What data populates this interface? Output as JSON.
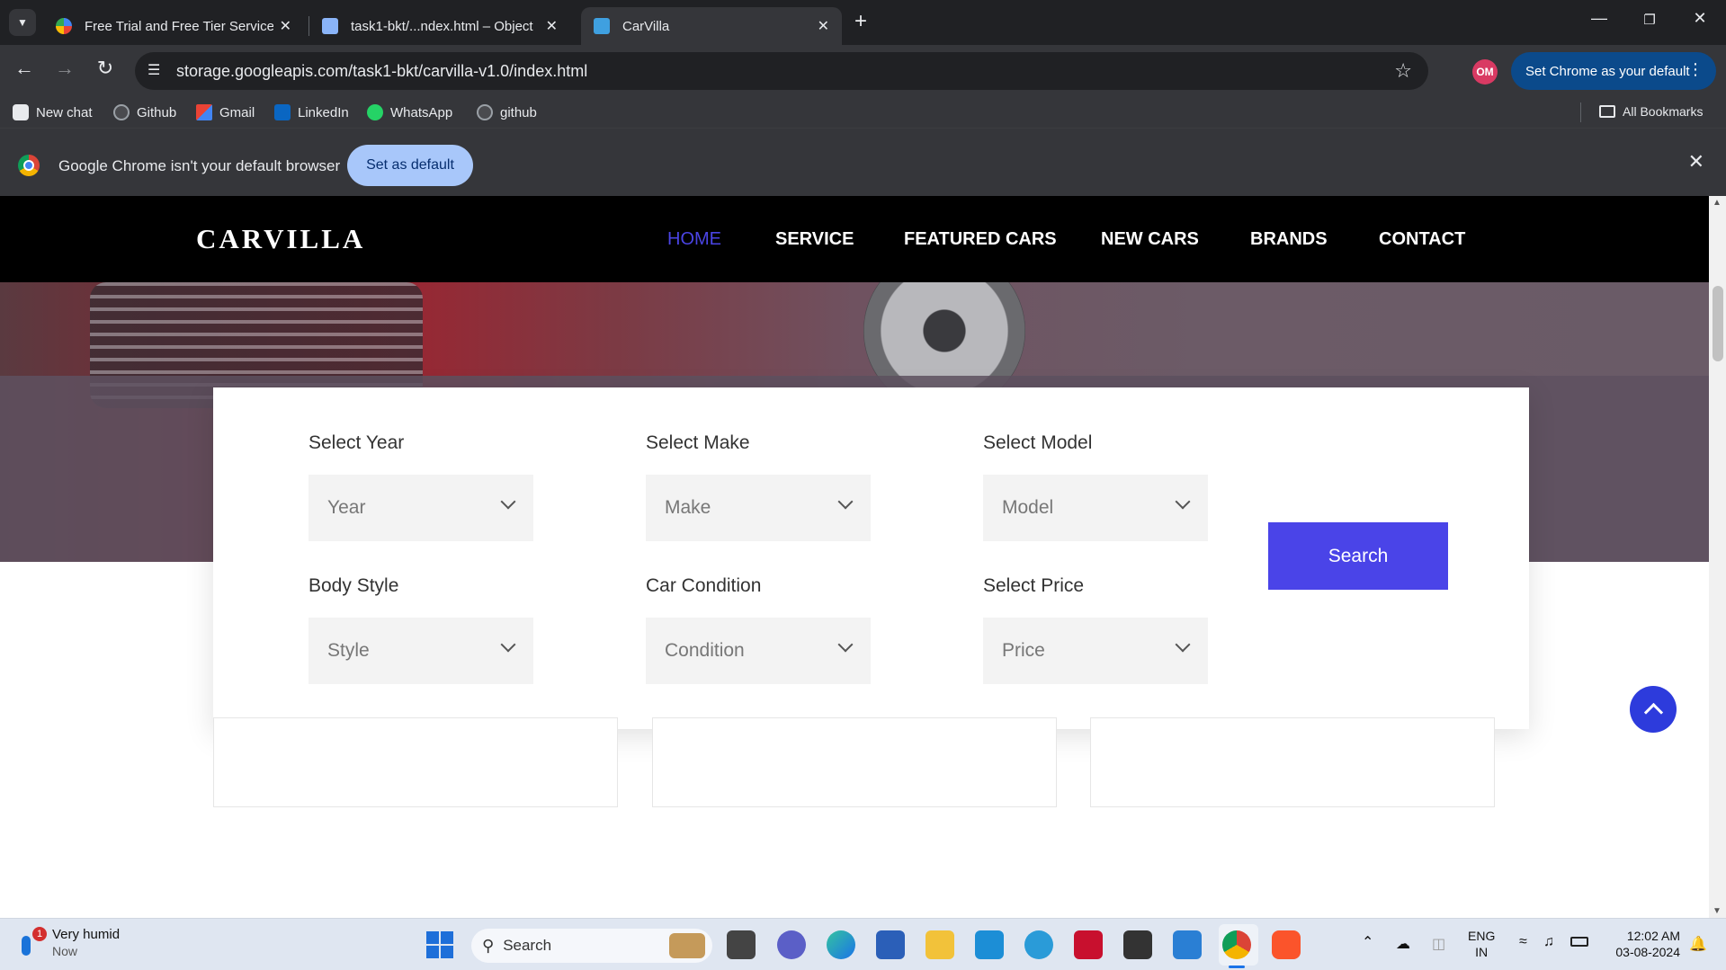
{
  "browser": {
    "tabs": [
      {
        "title": "Free Trial and Free Tier Services",
        "favicon": "google-cloud-icon",
        "active": false
      },
      {
        "title": "task1-bkt/...ndex.html – Object",
        "favicon": "storage-bucket-icon",
        "active": false
      },
      {
        "title": "CarVilla",
        "favicon": "carvilla-icon",
        "active": true
      }
    ],
    "url": "storage.googleapis.com/task1-bkt/carvilla-v1.0/index.html",
    "profile_initials": "OM",
    "set_default_label": "Set Chrome as your default",
    "bookmarks": [
      "New chat",
      "Github",
      "Gmail",
      "LinkedIn",
      "WhatsApp",
      "github"
    ],
    "all_bookmarks_label": "All Bookmarks",
    "infobar": {
      "message": "Google Chrome isn't your default browser",
      "button": "Set as default"
    }
  },
  "site": {
    "logo": "CARVILLA",
    "nav": [
      "HOME",
      "SERVICE",
      "FEATURED CARS",
      "NEW CARS",
      "BRANDS",
      "CONTACT"
    ],
    "accent_color": "#4a44e8",
    "search_form": {
      "fields": [
        {
          "label": "Select Year",
          "placeholder": "Year"
        },
        {
          "label": "Select Make",
          "placeholder": "Make"
        },
        {
          "label": "Select Model",
          "placeholder": "Model"
        },
        {
          "label": "Body Style",
          "placeholder": "Style"
        },
        {
          "label": "Car Condition",
          "placeholder": "Condition"
        },
        {
          "label": "Select Price",
          "placeholder": "Price"
        }
      ],
      "search_button": "Search"
    }
  },
  "taskbar": {
    "weather_text": "Very humid",
    "weather_sub": "Now",
    "weather_badge": "1",
    "search_placeholder": "Search",
    "language": "ENG",
    "region": "IN",
    "time": "12:02 AM",
    "date": "03-08-2024"
  }
}
